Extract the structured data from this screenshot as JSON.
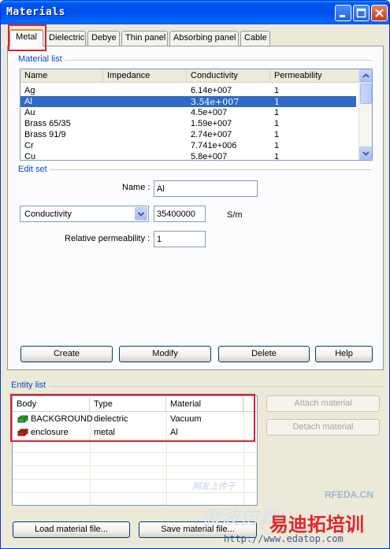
{
  "window": {
    "title": "Materials"
  },
  "tabs": [
    {
      "label": "Metal",
      "active": true
    },
    {
      "label": "Dielectric"
    },
    {
      "label": "Debye"
    },
    {
      "label": "Thin panel"
    },
    {
      "label": "Absorbing panel"
    },
    {
      "label": "Cable"
    }
  ],
  "material_list": {
    "title": "Material list",
    "columns": [
      "Name",
      "Impedance",
      "Conductivity",
      "Permeability"
    ],
    "rows": [
      {
        "name": "Ag",
        "impedance": "",
        "conductivity": "6.14e+007",
        "permeability": "1"
      },
      {
        "name": "Al",
        "impedance": "",
        "conductivity": "3.54e+007",
        "permeability": "1",
        "selected": true
      },
      {
        "name": "Au",
        "impedance": "",
        "conductivity": "4.5e+007",
        "permeability": "1"
      },
      {
        "name": "Brass 65/35",
        "impedance": "",
        "conductivity": "1.59e+007",
        "permeability": "1"
      },
      {
        "name": "Brass 91/9",
        "impedance": "",
        "conductivity": "2.74e+007",
        "permeability": "1"
      },
      {
        "name": "Cr",
        "impedance": "",
        "conductivity": "7.741e+006",
        "permeability": "1"
      },
      {
        "name": "Cu",
        "impedance": "",
        "conductivity": "5.8e+007",
        "permeability": "1"
      }
    ]
  },
  "edit_set": {
    "title": "Edit set",
    "name_label": "Name :",
    "name_value": "Al",
    "property_select": "Conductivity",
    "property_value": "35400000",
    "property_unit": "S/m",
    "permeability_label": "Relative permeability :",
    "permeability_value": "1"
  },
  "buttons": {
    "create": "Create",
    "modify": "Modify",
    "delete": "Delete",
    "help": "Help",
    "attach": "Attach material",
    "detach": "Detach material",
    "load": "Load material file...",
    "save": "Save material file..."
  },
  "entity_list": {
    "title": "Entity list",
    "columns": [
      "Body",
      "Type",
      "Material"
    ],
    "rows": [
      {
        "body": "BACKGROUND",
        "type": "dielectric",
        "material": "Vacuum",
        "icon_color": "#2fa82f"
      },
      {
        "body": "enclosure",
        "type": "metal",
        "material": "Al",
        "icon_color": "#c0241c"
      }
    ]
  },
  "watermarks": {
    "site": "RFEDA.CN",
    "url": "http://www.edatop.com",
    "brand_cn": "易迪拓培训",
    "cn_small": "微波仿真",
    "cn_faint": "网友上传于"
  },
  "colors": {
    "accent_red": "#e0212b",
    "selection": "#316ac5",
    "title_blue": "#0046d5"
  }
}
